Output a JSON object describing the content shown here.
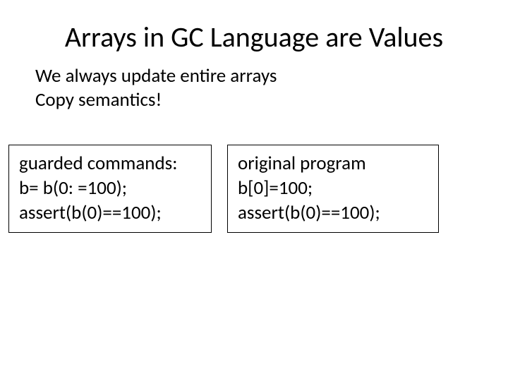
{
  "title": "Arrays in GC Language are Values",
  "sub_line1": "We always update entire arrays",
  "sub_line2": "Copy semantics!",
  "left_box": {
    "header": "guarded commands:",
    "line1": "b= b(0: =100);",
    "line2": "assert(b(0)==100);"
  },
  "right_box": {
    "header": "original program",
    "line1": "b[0]=100;",
    "line2": "assert(b(0)==100);"
  }
}
